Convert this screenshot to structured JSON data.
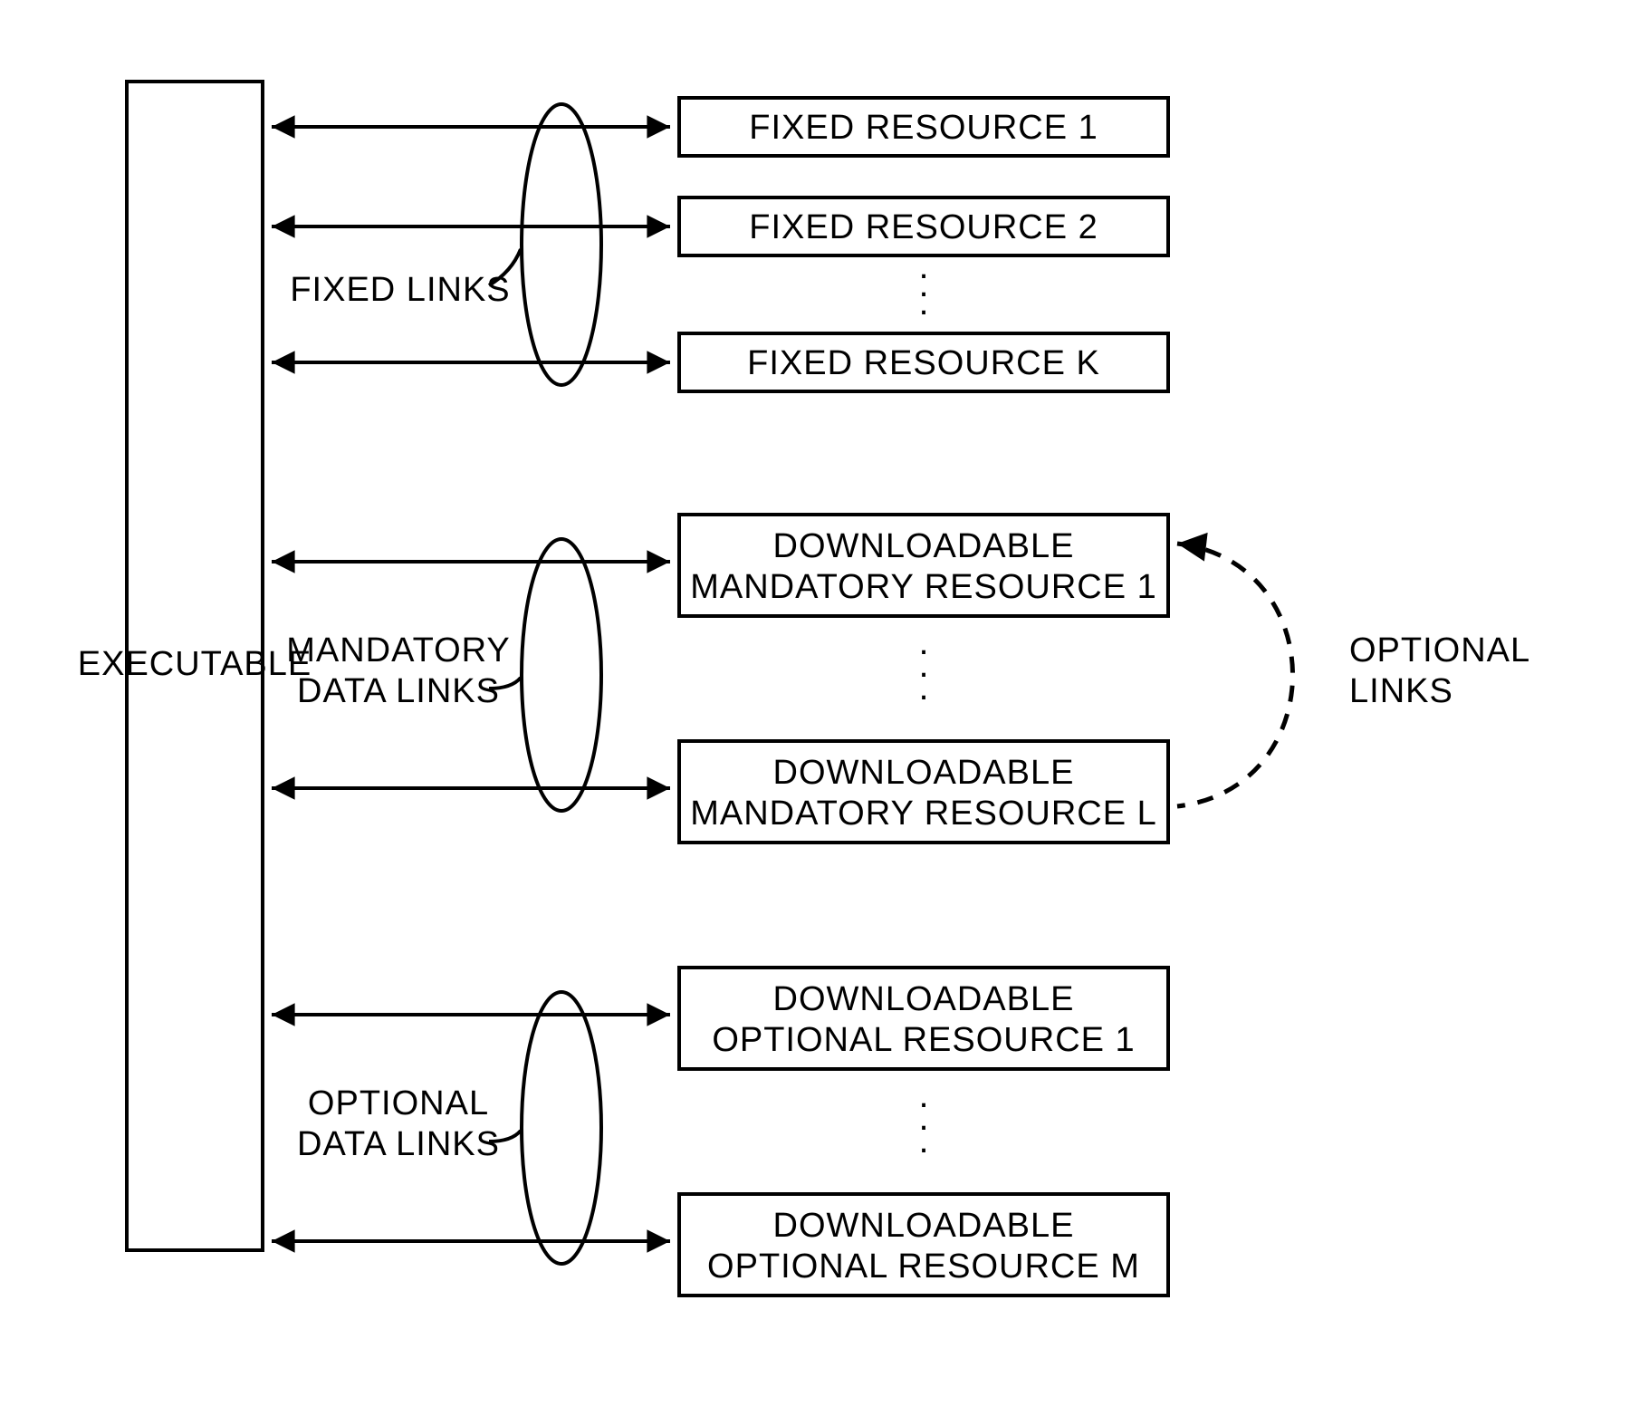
{
  "executable": {
    "label": "EXECUTABLE"
  },
  "groups": {
    "fixed": {
      "label": "FIXED LINKS"
    },
    "mandatory": {
      "label_l1": "MANDATORY",
      "label_l2": "DATA LINKS"
    },
    "optional": {
      "label_l1": "OPTIONAL",
      "label_l2": "DATA LINKS"
    }
  },
  "resources": {
    "fixed_1": "FIXED RESOURCE 1",
    "fixed_2": "FIXED RESOURCE 2",
    "fixed_k": "FIXED RESOURCE K",
    "mand_1_l1": "DOWNLOADABLE",
    "mand_1_l2": "MANDATORY RESOURCE 1",
    "mand_l_l1": "DOWNLOADABLE",
    "mand_l_l2": "MANDATORY RESOURCE L",
    "opt_1_l1": "DOWNLOADABLE",
    "opt_1_l2": "OPTIONAL RESOURCE 1",
    "opt_m_l1": "DOWNLOADABLE",
    "opt_m_l2": "OPTIONAL RESOURCE M"
  },
  "side": {
    "optional_links_l1": "OPTIONAL",
    "optional_links_l2": "LINKS"
  }
}
